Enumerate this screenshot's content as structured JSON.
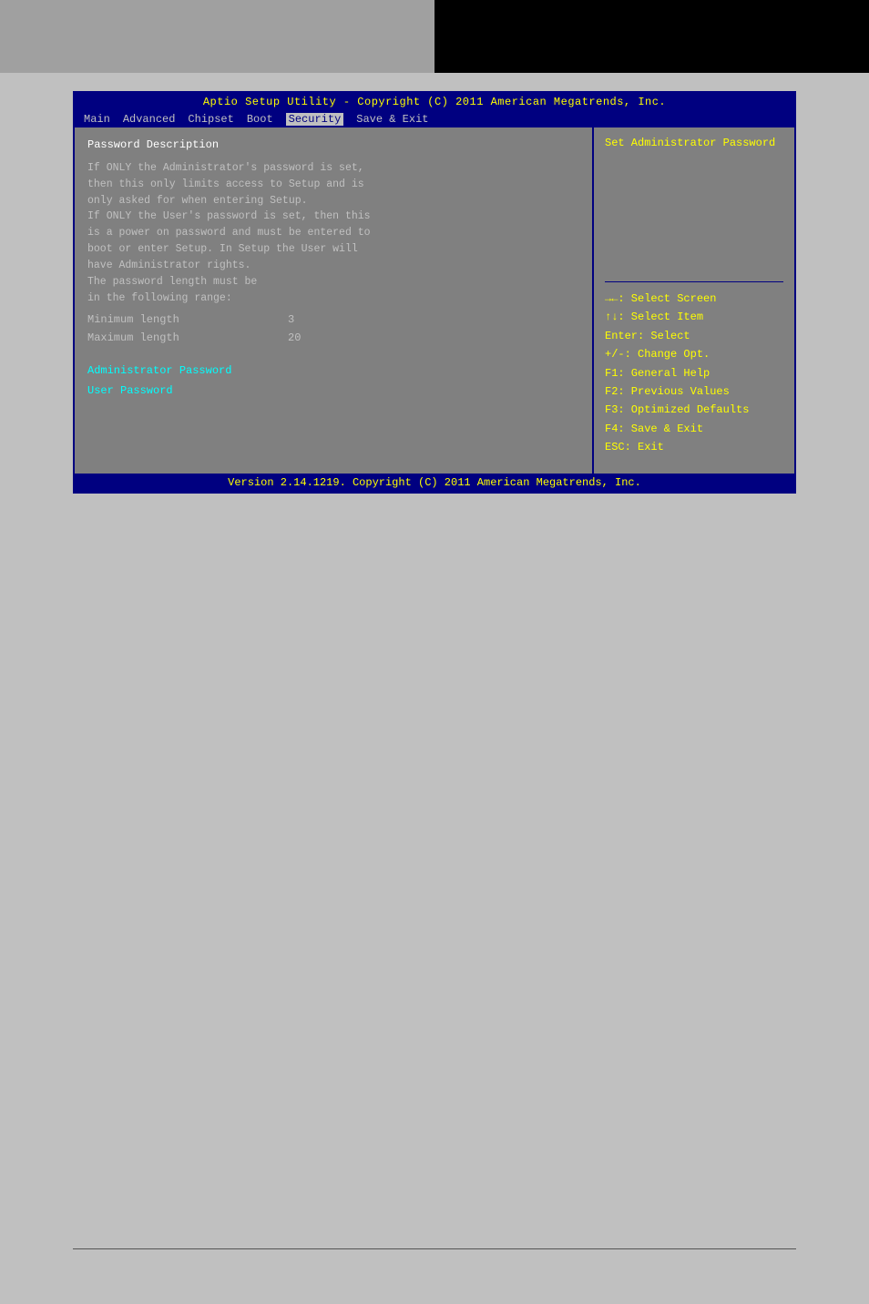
{
  "banner": {
    "left_bg": "#a0a0a0",
    "right_bg": "#000000"
  },
  "bios": {
    "title": "Aptio Setup Utility - Copyright (C) 2011 American Megatrends, Inc.",
    "menu_items": [
      "Main",
      "Advanced",
      "Chipset",
      "Boot",
      "Security",
      "Save & Exit"
    ],
    "active_menu": "Security",
    "left_panel": {
      "section_title": "Password Description",
      "description_lines": [
        "If ONLY the Administrator's password is set,",
        "then this only limits access to Setup and is",
        "only asked for when entering Setup.",
        "If ONLY the User's password is set, then this",
        "is a power on password and must be entered to",
        "boot or enter Setup. In Setup the User will",
        "have Administrator rights.",
        "The password length must be",
        "in the following range:"
      ],
      "fields": [
        {
          "label": "Minimum length",
          "value": "3"
        },
        {
          "label": "Maximum length",
          "value": "20"
        }
      ],
      "clickable_items": [
        "Administrator Password",
        "User Password"
      ]
    },
    "right_panel": {
      "top_text": "Set Administrator Password",
      "help_items": [
        "→←: Select Screen",
        "↑↓: Select Item",
        "Enter: Select",
        "+/-: Change Opt.",
        "F1: General Help",
        "F2: Previous Values",
        "F3: Optimized Defaults",
        "F4: Save & Exit",
        "ESC: Exit"
      ]
    },
    "footer": "Version 2.14.1219. Copyright (C) 2011 American Megatrends, Inc."
  }
}
